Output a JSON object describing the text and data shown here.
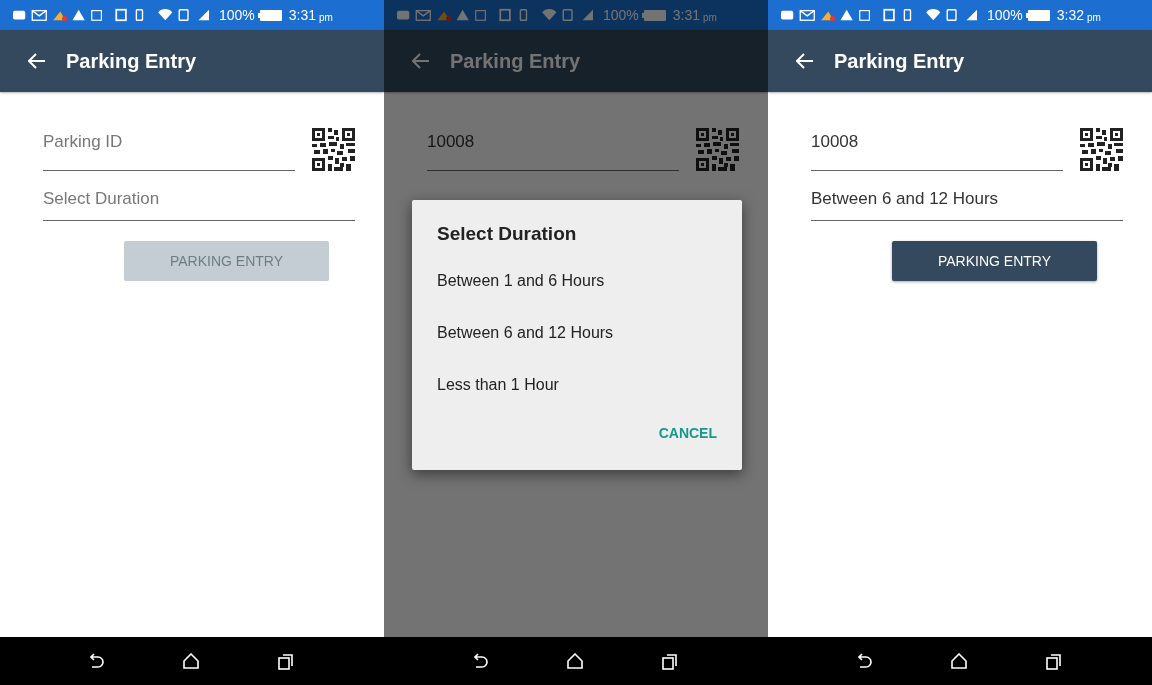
{
  "screens": [
    {
      "status_bar": {
        "battery": "100%",
        "time": "3:31",
        "period": "pm"
      },
      "app_bar": {
        "title": "Parking Entry"
      },
      "parking_id": {
        "placeholder": "Parking ID"
      },
      "duration": {
        "placeholder": "Select Duration"
      },
      "entry_button": {
        "label": "PARKING ENTRY",
        "disabled": true
      }
    },
    {
      "status_bar": {
        "battery": "100%",
        "time": "3:31",
        "period": "pm"
      },
      "app_bar": {
        "title": "Parking Entry"
      },
      "parking_id": {
        "value": "10008"
      },
      "dialog": {
        "title": "Select Duration",
        "options": [
          "Between 1 and 6 Hours",
          "Between 6 and 12 Hours",
          "Less than 1 Hour"
        ],
        "cancel": "CANCEL"
      }
    },
    {
      "status_bar": {
        "battery": "100%",
        "time": "3:32",
        "period": "pm"
      },
      "app_bar": {
        "title": "Parking Entry"
      },
      "parking_id": {
        "value": "10008"
      },
      "duration": {
        "value": "Between 6 and 12 Hours"
      },
      "entry_button": {
        "label": "PARKING ENTRY",
        "disabled": false
      }
    }
  ]
}
